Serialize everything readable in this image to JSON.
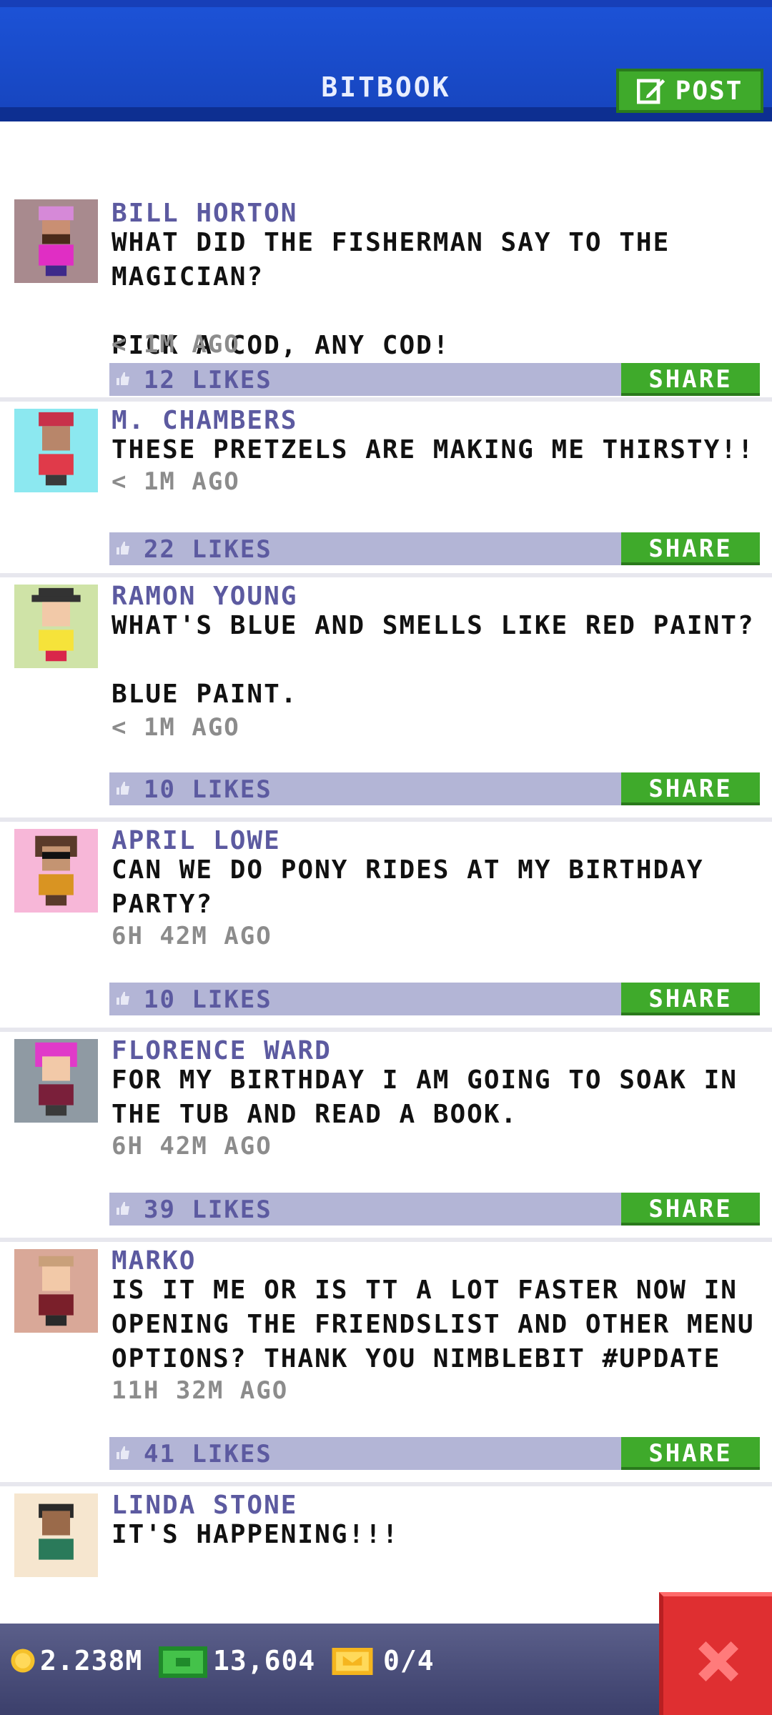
{
  "header": {
    "title": "BITBOOK",
    "post_label": "POST"
  },
  "posts": [
    {
      "name": "BILL HORTON",
      "message": "WHAT DID THE FISHERMAN SAY TO THE MAGICIAN?\n\nPICK A COD, ANY COD!",
      "time": "< 1M AGO",
      "likes": "12 LIKES",
      "share": "SHARE",
      "avatar_bg": "#a88a8e"
    },
    {
      "name": "M. CHAMBERS",
      "message": "THESE PRETZELS ARE MAKING ME THIRSTY!!",
      "time": "< 1M AGO",
      "likes": "22 LIKES",
      "share": "SHARE",
      "avatar_bg": "#8ce8f0"
    },
    {
      "name": "RAMON YOUNG",
      "message": "WHAT'S BLUE AND SMELLS LIKE RED PAINT?\n\nBLUE PAINT.",
      "time": "< 1M AGO",
      "likes": "10 LIKES",
      "share": "SHARE",
      "avatar_bg": "#cfe3a7"
    },
    {
      "name": "APRIL LOWE",
      "message": "CAN WE DO PONY RIDES AT MY BIRTHDAY PARTY?",
      "time": "6H 42M AGO",
      "likes": "10 LIKES",
      "share": "SHARE",
      "avatar_bg": "#f7b7d8"
    },
    {
      "name": "FLORENCE WARD",
      "message": "FOR MY BIRTHDAY I AM GOING TO SOAK IN THE TUB AND READ A BOOK.",
      "time": "6H 42M AGO",
      "likes": "39 LIKES",
      "share": "SHARE",
      "avatar_bg": "#8f9aa3"
    },
    {
      "name": "MARKO",
      "message": "IS IT ME OR IS TT A LOT FASTER NOW IN OPENING THE FRIENDSLIST AND OTHER MENU OPTIONS? THANK YOU NIMBLEBIT #UPDATE",
      "time": "11H 32M AGO",
      "likes": "41 LIKES",
      "share": "SHARE",
      "avatar_bg": "#d9a898"
    },
    {
      "name": "LINDA STONE",
      "message": "IT'S HAPPENING!!!",
      "avatar_bg": "#f6e6cf"
    }
  ],
  "status_bar": {
    "coins": "2.238M",
    "bux": "13,604",
    "tickets": "0/4"
  },
  "colors": {
    "header": "#1c52d6",
    "accent_green": "#3faa2b",
    "like_bar": "#b3b5d6",
    "name_text": "#5c5aa0",
    "close_red": "#df2f31"
  },
  "icons": {
    "post": "edit-icon",
    "like": "thumbs-up-icon",
    "coin": "coin-icon",
    "bux": "bux-icon",
    "ticket": "ticket-icon",
    "close": "close-icon"
  }
}
